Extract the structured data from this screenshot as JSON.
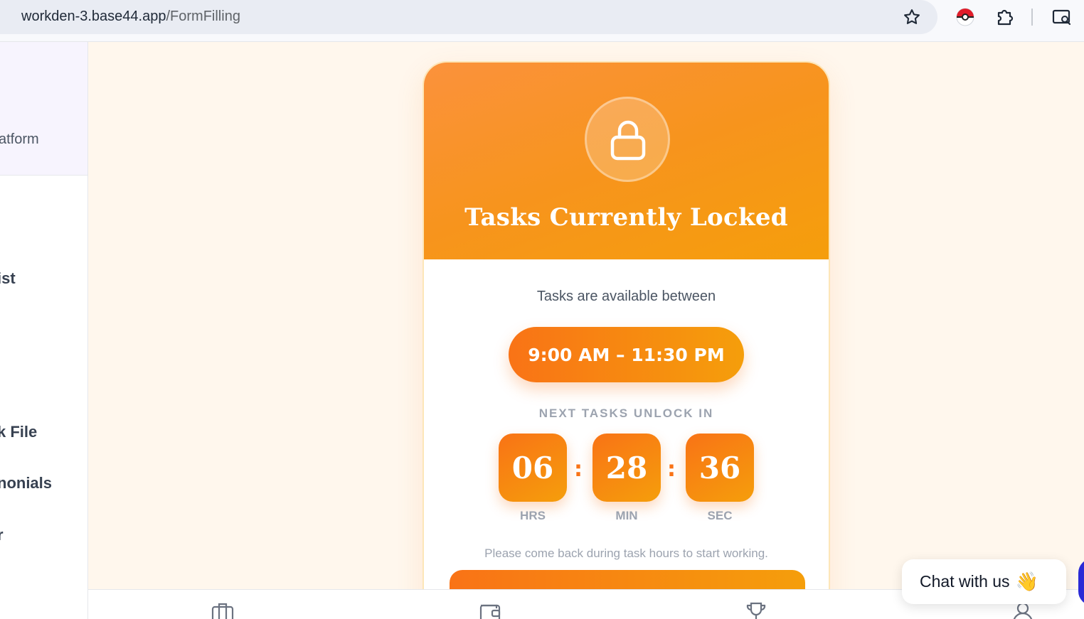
{
  "browser": {
    "url_host": "workden-3.base44.app",
    "url_path": "/FormFilling",
    "icons": [
      "site-info-icon",
      "star-icon",
      "pokeball-extension-icon",
      "extensions-puzzle-icon",
      "google-lens-icon"
    ]
  },
  "sidebar": {
    "tagline": "atform",
    "items": [
      {
        "label": "ist"
      },
      {
        "label": "k File"
      },
      {
        "label": "nonials"
      },
      {
        "label": "r"
      }
    ]
  },
  "card": {
    "title": "Tasks Currently Locked",
    "available_text": "Tasks are available between",
    "hours": "9:00 AM – 11:30 PM",
    "unlock_label": "NEXT TASKS UNLOCK IN",
    "countdown": {
      "hours": "06",
      "minutes": "28",
      "seconds": "36",
      "separator": ":",
      "hours_unit": "HRS",
      "minutes_unit": "MIN",
      "seconds_unit": "SEC"
    },
    "come_back_text": "Please come back during task hours to start working.",
    "colors": {
      "accent_start": "#f97316",
      "accent_end": "#f59e0b"
    }
  },
  "bottom_nav": {
    "icons": [
      "briefcase-icon",
      "wallet-icon",
      "trophy-icon",
      "user-icon"
    ]
  },
  "chat": {
    "label": "Chat with us",
    "emoji": "👋"
  }
}
